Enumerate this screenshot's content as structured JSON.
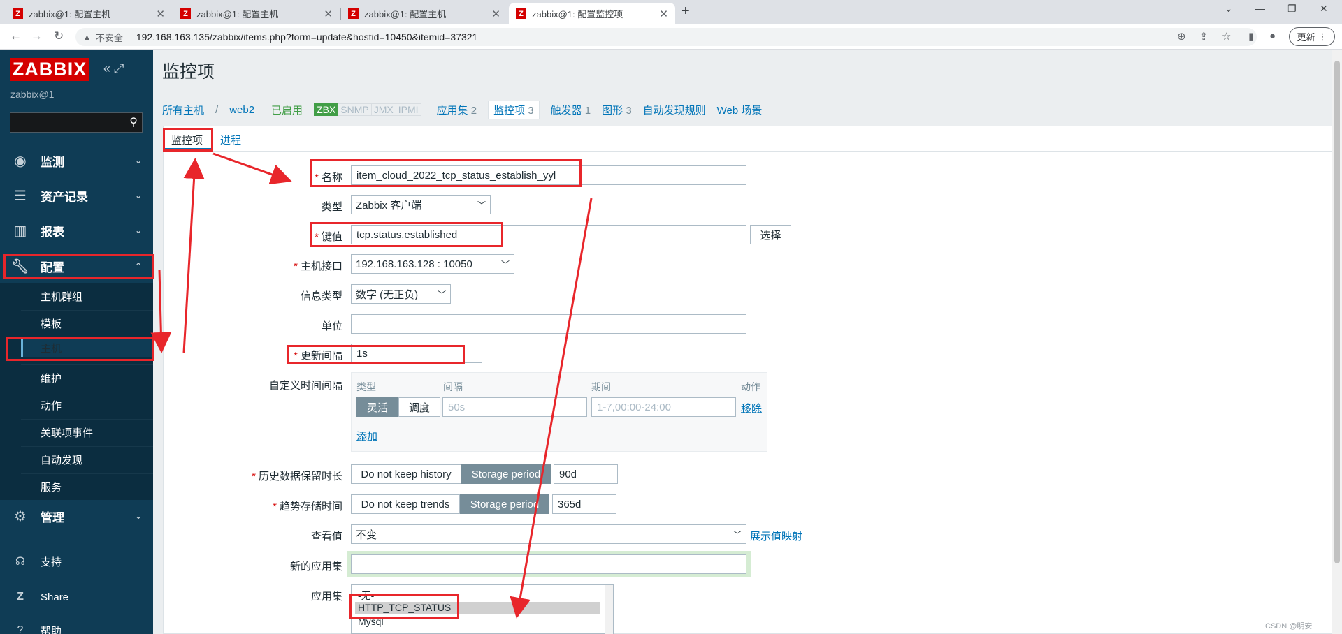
{
  "browser": {
    "tabs": [
      {
        "title": "zabbix@1: 配置主机",
        "active": false
      },
      {
        "title": "zabbix@1: 配置主机",
        "active": false
      },
      {
        "title": "zabbix@1: 配置主机",
        "active": false
      },
      {
        "title": "zabbix@1: 配置监控项",
        "active": true
      }
    ],
    "insecure_label": "不安全",
    "url": "192.168.163.135/zabbix/items.php?form=update&hostid=10450&itemid=37321",
    "update_label": "更新"
  },
  "sidebar": {
    "logo": "ZABBIX",
    "user": "zabbix@1",
    "menus": [
      {
        "label": "监测",
        "icon": "eye-icon"
      },
      {
        "label": "资产记录",
        "icon": "list-icon"
      },
      {
        "label": "报表",
        "icon": "bar-chart-icon"
      },
      {
        "label": "配置",
        "icon": "wrench-icon"
      }
    ],
    "config_submenu": [
      "主机群组",
      "模板",
      "主机",
      "维护",
      "动作",
      "关联项事件",
      "自动发现",
      "服务"
    ],
    "admin_label": "管理",
    "support_label": "支持",
    "share_label": "Share",
    "help_label": "帮助"
  },
  "page": {
    "title": "监控项",
    "breadcrumbs": {
      "all_hosts": "所有主机",
      "host": "web2",
      "status": "已启用",
      "zbx": "ZBX",
      "snmp": "SNMP",
      "jmx": "JMX",
      "ipmi": "IPMI",
      "apps": "应用集",
      "apps_count": "2",
      "items": "监控项",
      "items_count": "3",
      "triggers": "触发器",
      "triggers_count": "1",
      "graphs": "图形",
      "graphs_count": "3",
      "discovery": "自动发现规则",
      "web": "Web 场景"
    },
    "form_tabs": [
      "监控项",
      "进程"
    ]
  },
  "form": {
    "name_label": "名称",
    "name_value": "item_cloud_2022_tcp_status_establish_yyl",
    "type_label": "类型",
    "type_value": "Zabbix 客户端",
    "key_label": "键值",
    "key_value": "tcp.status.established",
    "select_button": "选择",
    "interface_label": "主机接口",
    "interface_value": "192.168.163.128 : 10050",
    "info_type_label": "信息类型",
    "info_type_value": "数字 (无正负)",
    "units_label": "单位",
    "units_value": "",
    "interval_label": "更新间隔",
    "interval_value": "1s",
    "custom_label": "自定义时间间隔",
    "custom_headers": {
      "type": "类型",
      "interval": "间隔",
      "period": "期间",
      "action": "动作"
    },
    "custom_row": {
      "flexible": "灵活",
      "scheduling": "调度",
      "interval_placeholder": "50s",
      "period_placeholder": "1-7,00:00-24:00",
      "remove": "移除"
    },
    "add_link": "添加",
    "history_label": "历史数据保留时长",
    "history_opt_off": "Do not keep history",
    "history_opt_on": "Storage period",
    "history_value": "90d",
    "trends_label": "趋势存储时间",
    "trends_opt_off": "Do not keep trends",
    "trends_opt_on": "Storage period",
    "trends_value": "365d",
    "valuemap_label": "查看值",
    "valuemap_value": "不变",
    "valuemap_link": "展示值映射",
    "new_app_label": "新的应用集",
    "new_app_value": "",
    "apps_label": "应用集",
    "apps_options": [
      "-无-",
      "HTTP_TCP_STATUS",
      "Mysql"
    ]
  },
  "watermark": "CSDN @明安"
}
